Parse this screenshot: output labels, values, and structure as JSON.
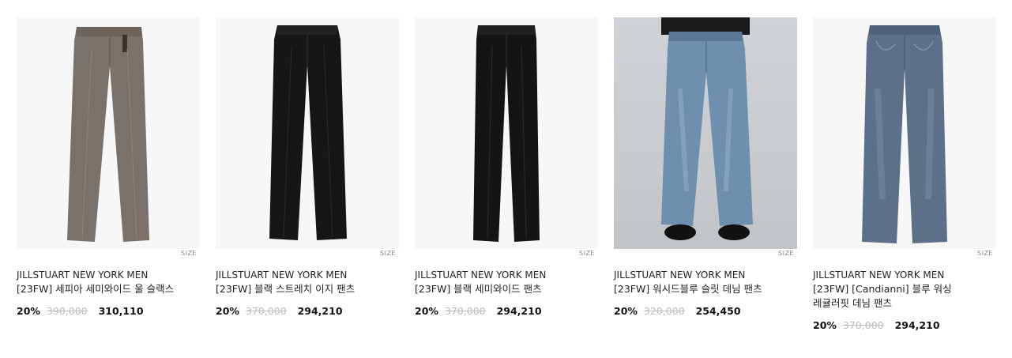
{
  "products": [
    {
      "brand": "JILLSTUART NEW YORK MEN",
      "name": "[23FW] 세피아 세미와이드 울 슬랙스",
      "size_tag": "SIZE",
      "discount": "20%",
      "original_price": "390,000",
      "sale_price": "310,110",
      "color": "#7a716b"
    },
    {
      "brand": "JILLSTUART NEW YORK MEN",
      "name": "[23FW] 블랙 스트레치 이지 팬츠",
      "size_tag": "SIZE",
      "discount": "20%",
      "original_price": "370,000",
      "sale_price": "294,210",
      "color": "#161616"
    },
    {
      "brand": "JILLSTUART NEW YORK MEN",
      "name": "[23FW] 블랙 세미와이드 팬츠",
      "size_tag": "SIZE",
      "discount": "20%",
      "original_price": "370,000",
      "sale_price": "294,210",
      "color": "#141414"
    },
    {
      "brand": "JILLSTUART NEW YORK MEN",
      "name": "[23FW] 워시드블루 슬릿 데님 팬츠",
      "size_tag": "SIZE",
      "discount": "20%",
      "original_price": "320,000",
      "sale_price": "254,450",
      "color": "#6f8fae"
    },
    {
      "brand": "JILLSTUART NEW YORK MEN",
      "name": "[23FW] [Candianni] 블루 워싱 레귤러핏 데님 팬츠",
      "size_tag": "SIZE",
      "discount": "20%",
      "original_price": "370,000",
      "sale_price": "294,210",
      "color": "#5d7089"
    }
  ]
}
